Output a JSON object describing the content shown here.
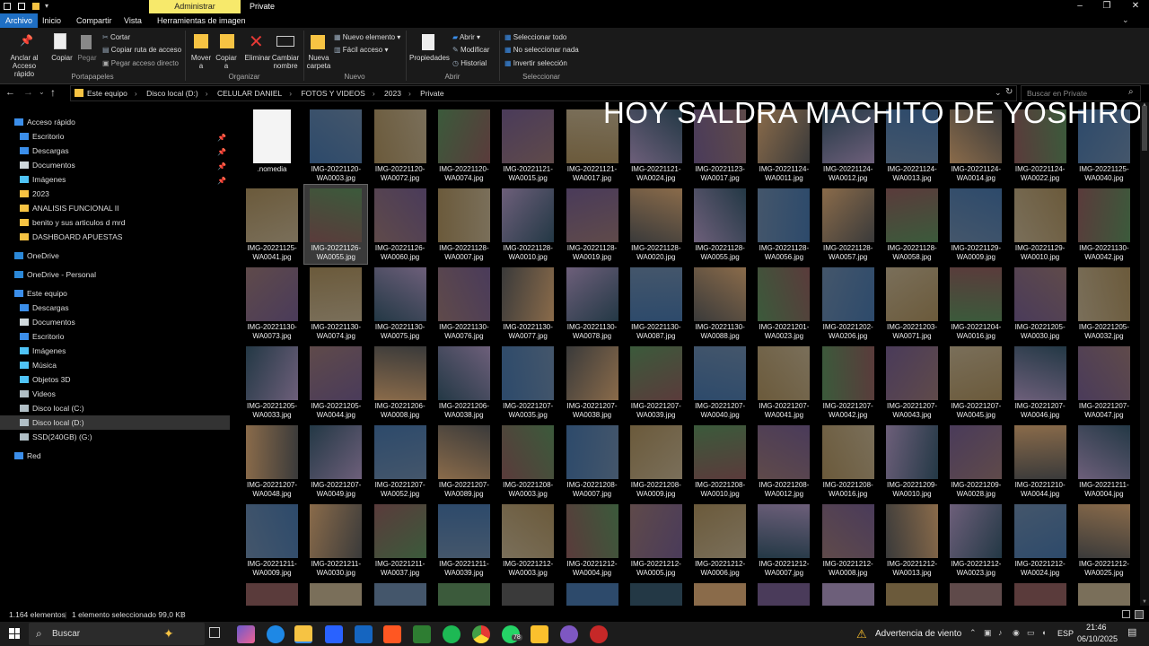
{
  "titlebar": {
    "context_tab": "Administrar",
    "title": "Private",
    "min": "–",
    "max": "❐",
    "close": "✕"
  },
  "tabs": [
    {
      "label": "Archivo"
    },
    {
      "label": "Inicio"
    },
    {
      "label": "Compartir"
    },
    {
      "label": "Vista"
    },
    {
      "label": "Herramientas de imagen"
    }
  ],
  "ribbon": {
    "pin": "Anclar al Acceso rápido",
    "copy": "Copiar",
    "paste": "Pegar",
    "cut": "Cortar",
    "copy_path": "Copiar ruta de acceso",
    "paste_shortcut": "Pegar acceso directo",
    "group_clipboard": "Portapapeles",
    "move_to": "Mover a",
    "copy_to": "Copiar a",
    "delete": "Eliminar",
    "rename": "Cambiar nombre",
    "group_organize": "Organizar",
    "new_folder": "Nueva carpeta",
    "new_item": "Nuevo elemento",
    "easy_access": "Fácil acceso",
    "group_new": "Nuevo",
    "properties": "Propiedades",
    "open": "Abrir",
    "edit": "Modificar",
    "history": "Historial",
    "group_open": "Abrir",
    "select_all": "Seleccionar todo",
    "select_none": "No seleccionar nada",
    "invert": "Invertir selección",
    "group_select": "Seleccionar"
  },
  "address": {
    "crumbs": [
      "Este equipo",
      "Disco local (D:)",
      "CELULAR DANIEL",
      "FOTOS Y VIDEOS",
      "2023",
      "Private"
    ],
    "search_placeholder": "Buscar en Private"
  },
  "nav": {
    "items": [
      {
        "label": "Acceso rápido",
        "icon": "star-icon",
        "color": "#3b8eea",
        "indent": 0,
        "pin": false
      },
      {
        "label": "Escritorio",
        "icon": "desktop-icon",
        "color": "#3b8eea",
        "indent": 1,
        "pin": true
      },
      {
        "label": "Descargas",
        "icon": "download-icon",
        "color": "#3b8eea",
        "indent": 1,
        "pin": true
      },
      {
        "label": "Documentos",
        "icon": "document-icon",
        "color": "#cfd8dc",
        "indent": 1,
        "pin": true
      },
      {
        "label": "Imágenes",
        "icon": "pictures-icon",
        "color": "#4fc3f7",
        "indent": 1,
        "pin": true
      },
      {
        "label": "2023",
        "icon": "folder-icon",
        "color": "#f6c343",
        "indent": 1,
        "pin": false
      },
      {
        "label": "ANALISIS FUNCIONAL II",
        "icon": "folder-icon",
        "color": "#f6c343",
        "indent": 1,
        "pin": false
      },
      {
        "label": "benito y sus articulos d mrd",
        "icon": "folder-icon",
        "color": "#f6c343",
        "indent": 1,
        "pin": false
      },
      {
        "label": "DASHBOARD APUESTAS",
        "icon": "folder-icon",
        "color": "#f6c343",
        "indent": 1,
        "pin": false
      },
      {
        "label": "OneDrive",
        "icon": "cloud-icon",
        "color": "#2b88d8",
        "indent": 0,
        "pin": false,
        "gap": true
      },
      {
        "label": "OneDrive - Personal",
        "icon": "cloud-icon",
        "color": "#2b88d8",
        "indent": 0,
        "pin": false,
        "gap": true
      },
      {
        "label": "Este equipo",
        "icon": "computer-icon",
        "color": "#3b8eea",
        "indent": 0,
        "pin": false,
        "gap": true
      },
      {
        "label": "Descargas",
        "icon": "download-icon",
        "color": "#3b8eea",
        "indent": 1,
        "pin": false
      },
      {
        "label": "Documentos",
        "icon": "document-icon",
        "color": "#cfd8dc",
        "indent": 1,
        "pin": false
      },
      {
        "label": "Escritorio",
        "icon": "desktop-icon",
        "color": "#3b8eea",
        "indent": 1,
        "pin": false
      },
      {
        "label": "Imágenes",
        "icon": "pictures-icon",
        "color": "#4fc3f7",
        "indent": 1,
        "pin": false
      },
      {
        "label": "Música",
        "icon": "music-icon",
        "color": "#4fc3f7",
        "indent": 1,
        "pin": false
      },
      {
        "label": "Objetos 3D",
        "icon": "cube-icon",
        "color": "#4fc3f7",
        "indent": 1,
        "pin": false
      },
      {
        "label": "Videos",
        "icon": "video-icon",
        "color": "#b0bec5",
        "indent": 1,
        "pin": false
      },
      {
        "label": "Disco local (C:)",
        "icon": "drive-icon",
        "color": "#b0bec5",
        "indent": 1,
        "pin": false
      },
      {
        "label": "Disco local (D:)",
        "icon": "drive-icon",
        "color": "#b0bec5",
        "indent": 1,
        "pin": false,
        "selected": true
      },
      {
        "label": "SSD(240GB) (G:)",
        "icon": "drive-icon",
        "color": "#b0bec5",
        "indent": 1,
        "pin": false
      },
      {
        "label": "Red",
        "icon": "network-icon",
        "color": "#3b8eea",
        "indent": 0,
        "pin": false,
        "gap": true
      }
    ]
  },
  "overlay_text": "HOY SALDRA MACHITO DE YOSHIRO?",
  "files": [
    ".nomedia",
    "IMG-20221120-WA0003.jpg",
    "IMG-20221120-WA0072.jpg",
    "IMG-20221120-WA0074.jpg",
    "IMG-20221121-WA0015.jpg",
    "IMG-20221121-WA0017.jpg",
    "IMG-20221121-WA0024.jpg",
    "IMG-20221123-WA0017.jpg",
    "IMG-20221124-WA0011.jpg",
    "IMG-20221124-WA0012.jpg",
    "IMG-20221124-WA0013.jpg",
    "IMG-20221124-WA0014.jpg",
    "IMG-20221124-WA0022.jpg",
    "IMG-20221125-WA0040.jpg",
    "IMG-20221125-WA0041.jpg",
    "IMG-20221126-WA0055.jpg",
    "IMG-20221126-WA0060.jpg",
    "IMG-20221128-WA0007.jpg",
    "IMG-20221128-WA0010.jpg",
    "IMG-20221128-WA0019.jpg",
    "IMG-20221128-WA0020.jpg",
    "IMG-20221128-WA0055.jpg",
    "IMG-20221128-WA0056.jpg",
    "IMG-20221128-WA0057.jpg",
    "IMG-20221128-WA0058.jpg",
    "IMG-20221129-WA0009.jpg",
    "IMG-20221129-WA0010.jpg",
    "IMG-20221130-WA0042.jpg",
    "IMG-20221130-WA0073.jpg",
    "IMG-20221130-WA0074.jpg",
    "IMG-20221130-WA0075.jpg",
    "IMG-20221130-WA0076.jpg",
    "IMG-20221130-WA0077.jpg",
    "IMG-20221130-WA0078.jpg",
    "IMG-20221130-WA0087.jpg",
    "IMG-20221130-WA0088.jpg",
    "IMG-20221201-WA0023.jpg",
    "IMG-20221202-WA0206.jpg",
    "IMG-20221203-WA0071.jpg",
    "IMG-20221204-WA0016.jpg",
    "IMG-20221205-WA0030.jpg",
    "IMG-20221205-WA0032.jpg",
    "IMG-20221205-WA0033.jpg",
    "IMG-20221205-WA0044.jpg",
    "IMG-20221206-WA0008.jpg",
    "IMG-20221206-WA0038.jpg",
    "IMG-20221207-WA0035.jpg",
    "IMG-20221207-WA0038.jpg",
    "IMG-20221207-WA0039.jpg",
    "IMG-20221207-WA0040.jpg",
    "IMG-20221207-WA0041.jpg",
    "IMG-20221207-WA0042.jpg",
    "IMG-20221207-WA0043.jpg",
    "IMG-20221207-WA0045.jpg",
    "IMG-20221207-WA0046.jpg",
    "IMG-20221207-WA0047.jpg",
    "IMG-20221207-WA0048.jpg",
    "IMG-20221207-WA0049.jpg",
    "IMG-20221207-WA0052.jpg",
    "IMG-20221207-WA0089.jpg",
    "IMG-20221208-WA0003.jpg",
    "IMG-20221208-WA0007.jpg",
    "IMG-20221208-WA0009.jpg",
    "IMG-20221208-WA0010.jpg",
    "IMG-20221208-WA0012.jpg",
    "IMG-20221208-WA0016.jpg",
    "IMG-20221209-WA0010.jpg",
    "IMG-20221209-WA0028.jpg",
    "IMG-20221210-WA0044.jpg",
    "IMG-20221211-WA0004.jpg",
    "IMG-20221211-WA0009.jpg",
    "IMG-20221211-WA0030.jpg",
    "IMG-20221211-WA0037.jpg",
    "IMG-20221211-WA0039.jpg",
    "IMG-20221212-WA0003.jpg",
    "IMG-20221212-WA0004.jpg",
    "IMG-20221212-WA0005.jpg",
    "IMG-20221212-WA0006.jpg",
    "IMG-20221212-WA0007.jpg",
    "IMG-20221212-WA0008.jpg",
    "IMG-20221212-WA0013.jpg",
    "IMG-20221212-WA0023.jpg",
    "IMG-20221212-WA0024.jpg",
    "IMG-20221212-WA0025.jpg"
  ],
  "selected_file": "IMG-20221126-WA0055.jpg",
  "status": {
    "count": "1.164 elementos",
    "selected": "1 elemento seleccionado 99,0 KB"
  },
  "taskbar": {
    "search": "Buscar",
    "weather": "Advertencia de viento",
    "lang": "ESP",
    "time": "21:46",
    "date": "06/10/2025",
    "whatsapp_badge": "78"
  }
}
